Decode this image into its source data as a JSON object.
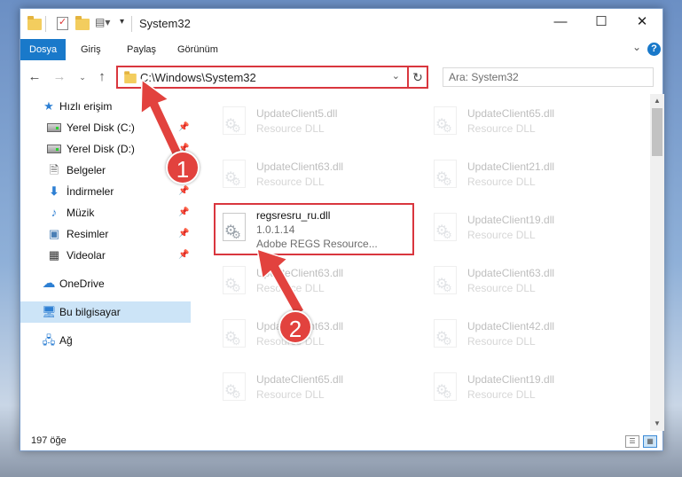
{
  "window": {
    "title": "System32",
    "controls": {
      "minimize": "—",
      "maximize": "☐",
      "close": "✕"
    }
  },
  "ribbon": {
    "tabs": [
      {
        "label": "Dosya",
        "active": true
      },
      {
        "label": "Giriş",
        "active": false
      },
      {
        "label": "Paylaş",
        "active": false
      },
      {
        "label": "Görünüm",
        "active": false
      }
    ],
    "help": "?"
  },
  "address_bar": {
    "path": "C:\\Windows\\System32"
  },
  "search": {
    "placeholder": "Ara: System32"
  },
  "sidebar": {
    "items": [
      {
        "label": "Hızlı erişim",
        "icon": "star-icon"
      },
      {
        "label": "Yerel Disk (C:)",
        "icon": "drive-icon",
        "pinned": true
      },
      {
        "label": "Yerel Disk (D:)",
        "icon": "drive-icon",
        "pinned": true
      },
      {
        "label": "Belgeler",
        "icon": "documents-icon",
        "pinned": true
      },
      {
        "label": "İndirmeler",
        "icon": "downloads-icon",
        "pinned": true
      },
      {
        "label": "Müzik",
        "icon": "music-icon",
        "pinned": true
      },
      {
        "label": "Resimler",
        "icon": "pictures-icon",
        "pinned": true
      },
      {
        "label": "Videolar",
        "icon": "videos-icon",
        "pinned": true
      },
      {
        "label": "OneDrive",
        "icon": "cloud-icon"
      },
      {
        "label": "Bu bilgisayar",
        "icon": "computer-icon",
        "selected": true
      },
      {
        "label": "Ağ",
        "icon": "network-icon"
      }
    ]
  },
  "files": {
    "left": [
      {
        "name": "UpdateClient5.dll",
        "sub": "Resource DLL"
      },
      {
        "name": "UpdateClient63.dll",
        "sub": "Resource DLL"
      },
      {
        "name": "regsresru_ru.dll",
        "version": "1.0.1.14",
        "sub": "Adobe REGS Resource...",
        "highlighted": true
      },
      {
        "name": "UpdateClient63.dll",
        "sub": "Resource DLL"
      },
      {
        "name": "UpdateClient63.dll",
        "sub": "Resource DLL"
      },
      {
        "name": "UpdateClient65.dll",
        "sub": "Resource DLL"
      }
    ],
    "right": [
      {
        "name": "UpdateClient65.dll",
        "sub": "Resource DLL"
      },
      {
        "name": "UpdateClient21.dll",
        "sub": "Resource DLL"
      },
      {
        "name": "UpdateClient19.dll",
        "sub": "Resource DLL"
      },
      {
        "name": "UpdateClient63.dll",
        "sub": "Resource DLL"
      },
      {
        "name": "UpdateClient42.dll",
        "sub": "Resource DLL"
      },
      {
        "name": "UpdateClient19.dll",
        "sub": "Resource DLL"
      }
    ]
  },
  "status": {
    "count": "197 öğe"
  },
  "annotations": {
    "step1": "1",
    "step2": "2",
    "accent": "#e2423e"
  }
}
